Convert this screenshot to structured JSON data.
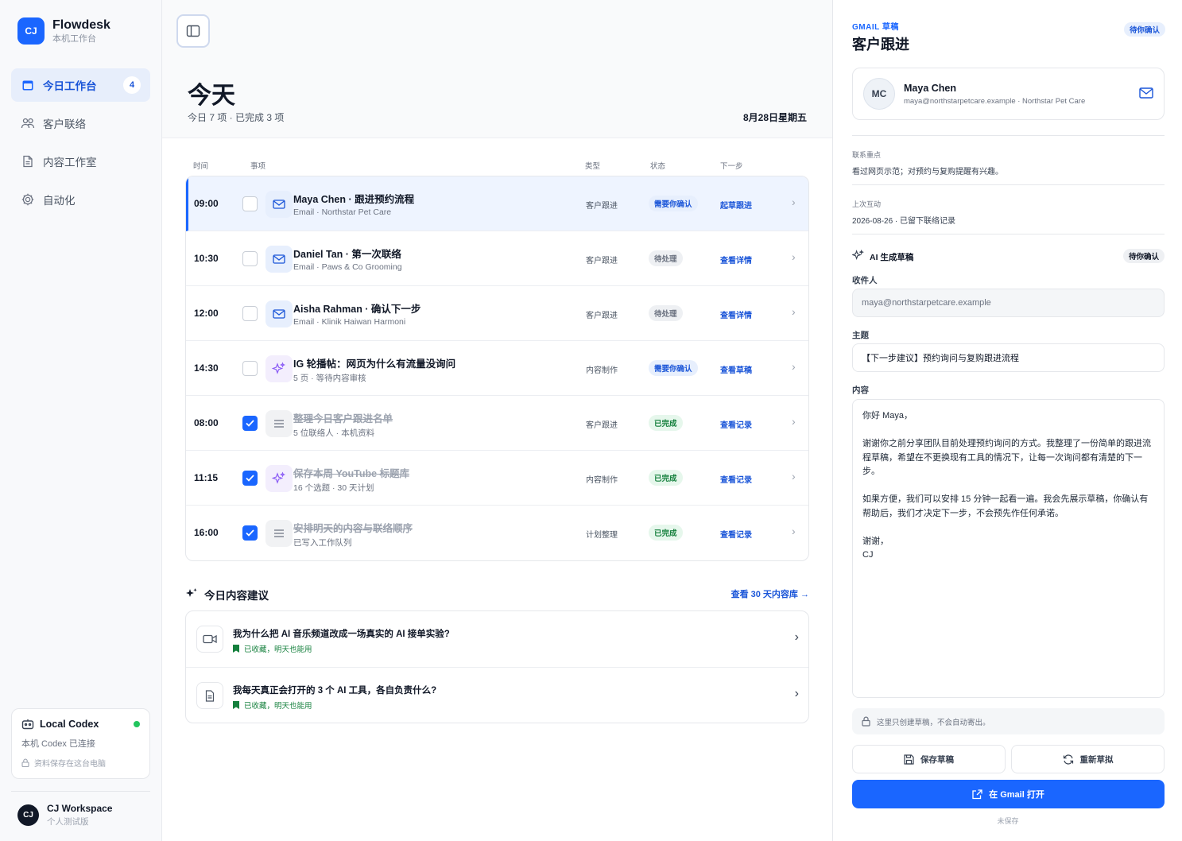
{
  "brand": {
    "logo": "CJ",
    "name": "Flowdesk",
    "subtitle": "本机工作台"
  },
  "nav": [
    {
      "label": "今日工作台",
      "badge": "4",
      "icon": "calendar-icon",
      "active": true
    },
    {
      "label": "客户联络",
      "icon": "users-icon"
    },
    {
      "label": "内容工作室",
      "icon": "document-icon"
    },
    {
      "label": "自动化",
      "icon": "gear-icon"
    }
  ],
  "codex": {
    "title": "Local Codex",
    "status": "本机 Codex 已连接",
    "note": "资料保存在这台电脑"
  },
  "workspace": {
    "avatar": "CJ",
    "name": "CJ Workspace",
    "plan": "个人测试版"
  },
  "header": {
    "title": "今天",
    "summary": "今日 7 项 · 已完成 3 项",
    "date": "8月28日星期五"
  },
  "columns": {
    "time": "时间",
    "item": "事项",
    "type": "类型",
    "status": "状态",
    "next": "下一步"
  },
  "tasks": [
    {
      "time": "09:00",
      "title": "Maya Chen · 跟进预约流程",
      "sub": "Email · Northstar Pet Care",
      "type": "客户跟进",
      "status": "需要你确认",
      "next": "起草跟进",
      "icon": "mail-icon",
      "checked": false,
      "selected": true
    },
    {
      "time": "10:30",
      "title": "Daniel Tan · 第一次联络",
      "sub": "Email · Paws & Co Grooming",
      "type": "客户跟进",
      "status": "待处理",
      "next": "查看详情",
      "icon": "mail-icon",
      "checked": false
    },
    {
      "time": "12:00",
      "title": "Aisha Rahman · 确认下一步",
      "sub": "Email · Klinik Haiwan Harmoni",
      "type": "客户跟进",
      "status": "待处理",
      "next": "查看详情",
      "icon": "mail-icon",
      "checked": false
    },
    {
      "time": "14:30",
      "title": "IG 轮播帖：网页为什么有流量没询问",
      "sub": "5 页 · 等待内容审核",
      "type": "内容制作",
      "status": "需要你确认",
      "next": "查看草稿",
      "icon": "sparkle-icon",
      "checked": false
    },
    {
      "time": "08:00",
      "title": "整理今日客户跟进名单",
      "sub": "5 位联络人 · 本机资料",
      "type": "客户跟进",
      "status": "已完成",
      "next": "查看记录",
      "icon": "list-icon",
      "checked": true
    },
    {
      "time": "11:15",
      "title": "保存本周 YouTube 标题库",
      "sub": "16 个选题 · 30 天计划",
      "type": "内容制作",
      "status": "已完成",
      "next": "查看记录",
      "icon": "sparkle-icon",
      "checked": true
    },
    {
      "time": "16:00",
      "title": "安排明天的内容与联络顺序",
      "sub": "已写入工作队列",
      "type": "计划整理",
      "status": "已完成",
      "next": "查看记录",
      "icon": "list-icon",
      "checked": true
    }
  ],
  "suggestions": {
    "title": "今日内容建议",
    "link": "查看 30 天内容库",
    "items": [
      {
        "title": "我为什么把 AI 音乐频道改成一场真实的 AI 接单实验?",
        "meta": "已收藏，明天也能用",
        "icon": "video-icon"
      },
      {
        "title": "我每天真正会打开的 3 个 AI 工具，各自负责什么?",
        "meta": "已收藏，明天也能用",
        "icon": "file-icon"
      }
    ]
  },
  "panel": {
    "eyebrow": "GMAIL 草稿",
    "title": "客户跟进",
    "pill": "待你确认",
    "contact": {
      "initials": "MC",
      "name": "Maya Chen",
      "email": "maya@northstarpetcare.example · Northstar Pet Care"
    },
    "focus_label": "联系重点",
    "focus_value": "看过网页示范；对预约与复购提醒有兴趣。",
    "last_label": "上次互动",
    "last_value": "2026-08-26 · 已留下联络记录",
    "ai_title": "AI 生成草稿",
    "ai_pill": "待你确认",
    "to_label": "收件人",
    "to_value": "maya@northstarpetcare.example",
    "subject_label": "主题",
    "subject_value": "【下一步建议】预约询问与复购跟进流程",
    "body_label": "内容",
    "body_value": "你好 Maya，\n\n谢谢你之前分享团队目前处理预约询问的方式。我整理了一份简单的跟进流程草稿，希望在不更换现有工具的情况下，让每一次询问都有清楚的下一步。\n\n如果方便，我们可以安排 15 分钟一起看一遍。我会先展示草稿，你确认有帮助后，我们才决定下一步，不会预先作任何承诺。\n\n谢谢，\nCJ",
    "note": "这里只创建草稿，不会自动寄出。",
    "save_label": "保存草稿",
    "regen_label": "重新草拟",
    "open_label": "在 Gmail 打开",
    "unsaved": "未保存"
  },
  "colors": {
    "accent": "#1a66ff",
    "success": "#15803d",
    "sparkle": "#8b5cf6"
  }
}
